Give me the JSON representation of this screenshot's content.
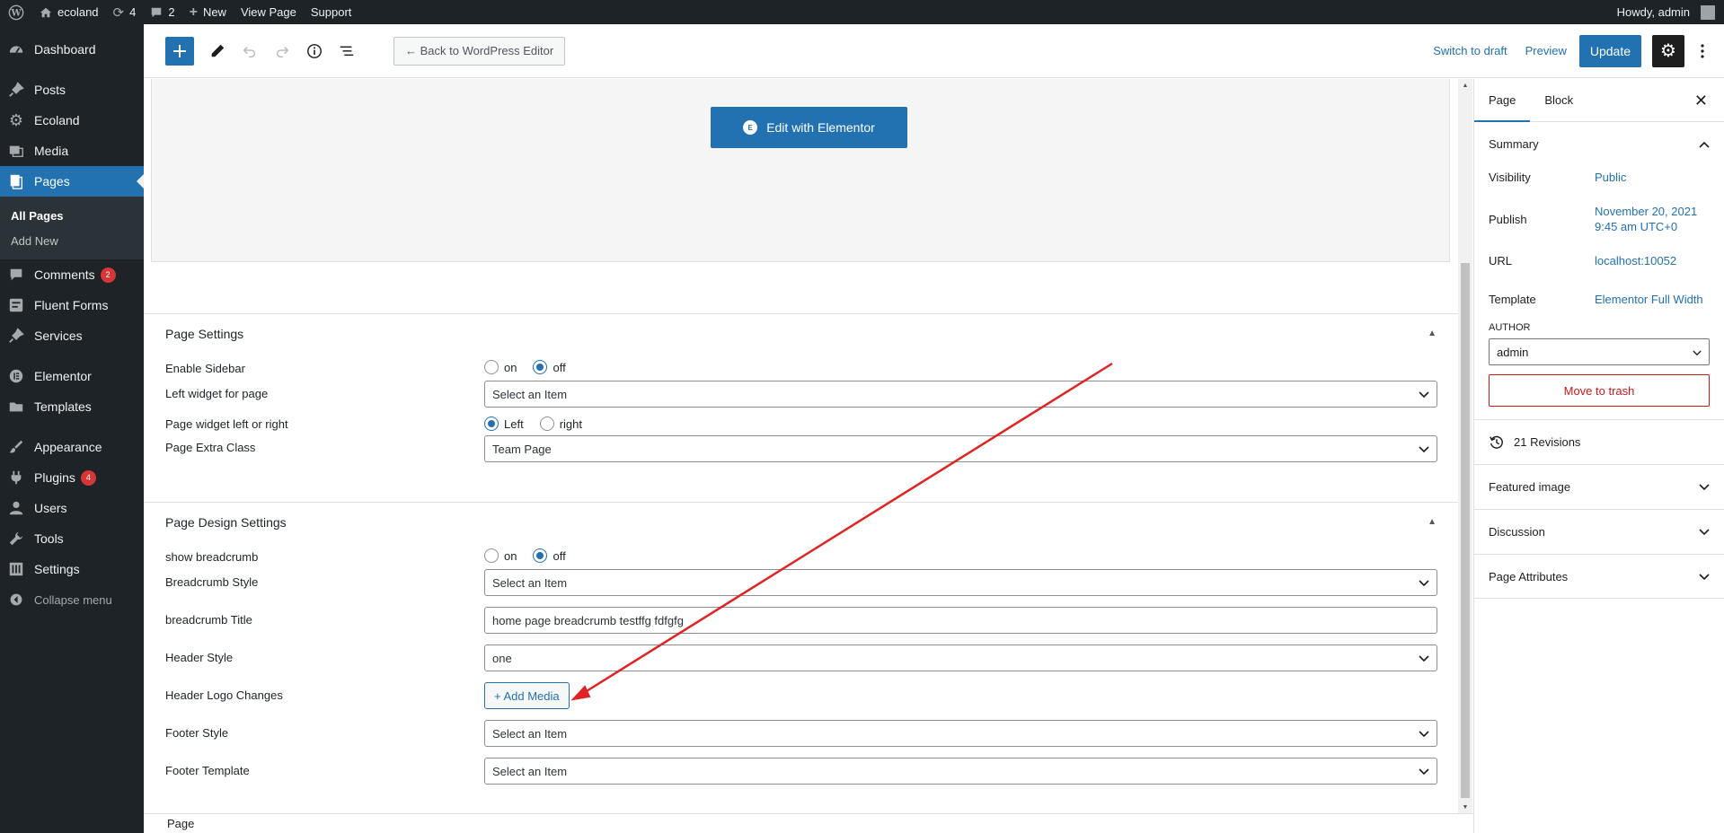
{
  "adminbar": {
    "site_name": "ecoland",
    "updates_count": "4",
    "comments_count": "2",
    "new_label": "New",
    "view_page_label": "View Page",
    "support_label": "Support",
    "howdy": "Howdy, admin"
  },
  "sidebar": {
    "items": [
      {
        "label": "Dashboard",
        "icon": "dashboard-icon"
      },
      {
        "label": "Posts",
        "icon": "pin-icon"
      },
      {
        "label": "Ecoland",
        "icon": "gear-icon"
      },
      {
        "label": "Media",
        "icon": "media-icon"
      },
      {
        "label": "Pages",
        "icon": "pages-icon"
      },
      {
        "label": "Comments",
        "icon": "comment-icon",
        "badge": "2"
      },
      {
        "label": "Fluent Forms",
        "icon": "form-icon"
      },
      {
        "label": "Services",
        "icon": "pin-icon"
      },
      {
        "label": "Elementor",
        "icon": "elementor-icon"
      },
      {
        "label": "Templates",
        "icon": "folder-icon"
      },
      {
        "label": "Appearance",
        "icon": "brush-icon"
      },
      {
        "label": "Plugins",
        "icon": "plugin-icon",
        "badge": "4"
      },
      {
        "label": "Users",
        "icon": "user-icon"
      },
      {
        "label": "Tools",
        "icon": "wrench-icon"
      },
      {
        "label": "Settings",
        "icon": "settings-icon"
      }
    ],
    "submenu": [
      "All Pages",
      "Add New"
    ],
    "collapse_label": "Collapse menu"
  },
  "header": {
    "back_label": "← Back to WordPress Editor",
    "switch_draft": "Switch to draft",
    "preview": "Preview",
    "update": "Update"
  },
  "elementor": {
    "button_label": "Edit with Elementor"
  },
  "page_settings": {
    "title": "Page Settings",
    "enable_sidebar_label": "Enable Sidebar",
    "left_widget_label": "Left widget for page",
    "left_widget_value": "Select an Item",
    "widget_side_label": "Page widget left or right",
    "extra_class_label": "Page Extra Class",
    "extra_class_value": "Team Page",
    "on": "on",
    "off": "off",
    "left": "Left",
    "right": "right"
  },
  "design_settings": {
    "title": "Page Design Settings",
    "show_breadcrumb_label": "show breadcrumb",
    "breadcrumb_style_label": "Breadcrumb Style",
    "breadcrumb_style_value": "Select an Item",
    "breadcrumb_title_label": "breadcrumb Title",
    "breadcrumb_title_value": "home page breadcrumb testffg fdfgfg",
    "header_style_label": "Header Style",
    "header_style_value": "one",
    "header_logo_label": "Header Logo Changes",
    "add_media_label": "+ Add Media",
    "footer_style_label": "Footer Style",
    "footer_style_value": "Select an Item",
    "footer_template_label": "Footer Template",
    "footer_template_value": "Select an Item"
  },
  "settings_panel": {
    "tab_page": "Page",
    "tab_block": "Block",
    "summary_title": "Summary",
    "visibility_label": "Visibility",
    "visibility_value": "Public",
    "publish_label": "Publish",
    "publish_date": "November 20, 2021",
    "publish_time": "9:45 am UTC+0",
    "url_label": "URL",
    "url_value": "localhost:10052",
    "template_label": "Template",
    "template_value": "Elementor Full Width",
    "author_label": "AUTHOR",
    "author_value": "admin",
    "trash_label": "Move to trash",
    "revisions_label": "21 Revisions",
    "featured_image": "Featured image",
    "discussion": "Discussion",
    "page_attributes": "Page Attributes"
  },
  "footer": {
    "breadcrumb": "Page"
  },
  "colors": {
    "admin_dark": "#1d2327",
    "accent": "#2271b1",
    "danger": "#d63638",
    "annotation_arrow": "#e02424"
  }
}
